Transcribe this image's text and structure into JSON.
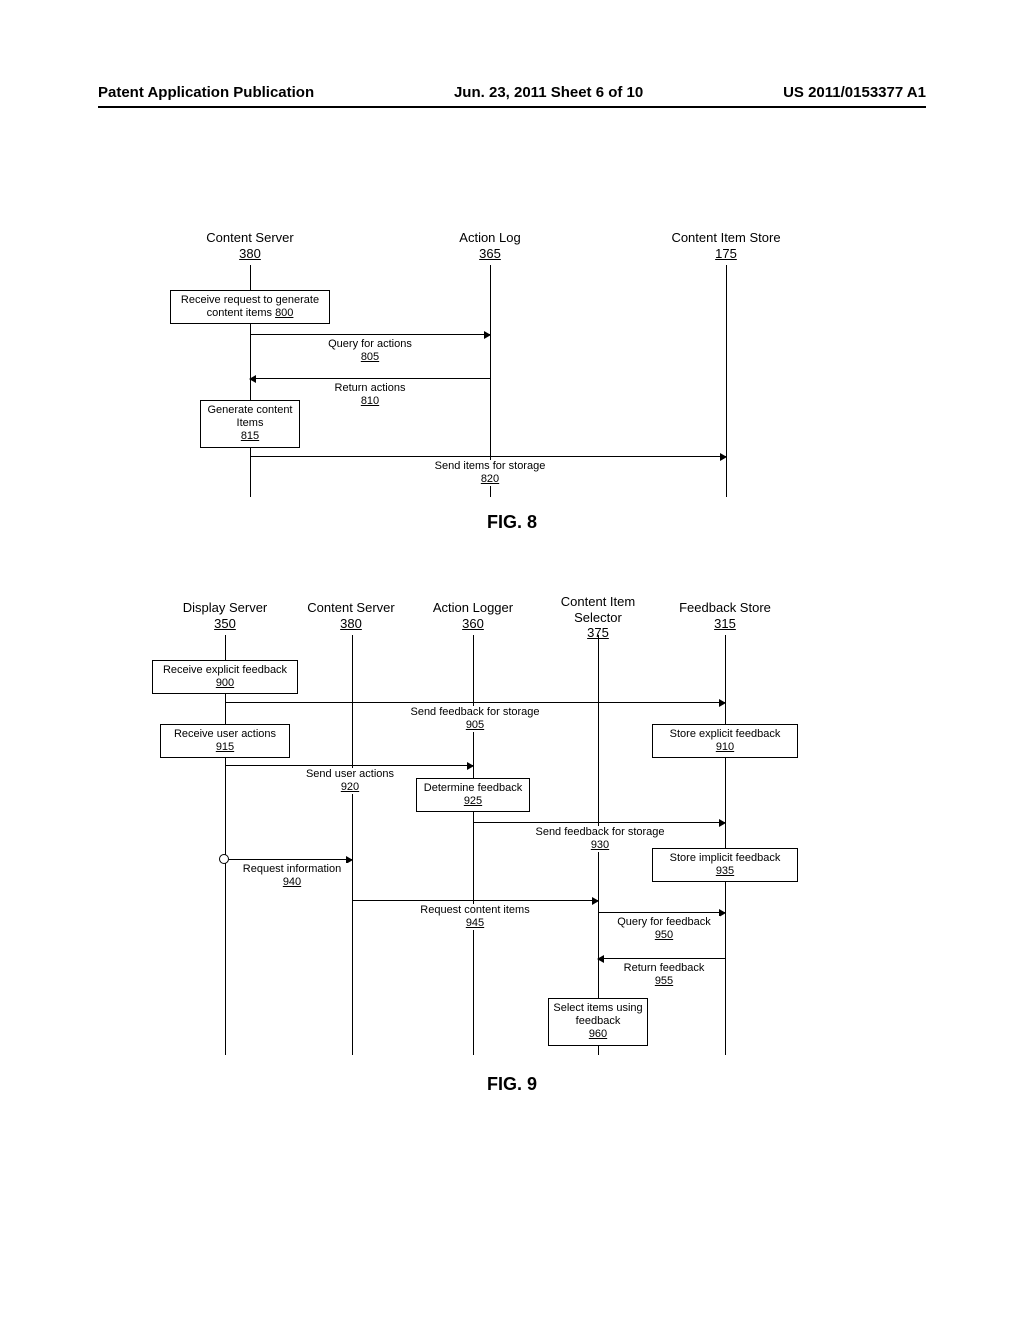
{
  "header": {
    "left": "Patent Application Publication",
    "center": "Jun. 23, 2011  Sheet 6 of 10",
    "right": "US 2011/0153377 A1"
  },
  "fig8": {
    "label": "FIG. 8",
    "lanes": [
      {
        "title": "Content Server",
        "num": "380"
      },
      {
        "title": "Action Log",
        "num": "365"
      },
      {
        "title": "Content Item Store",
        "num": "175"
      }
    ],
    "boxes": {
      "b800": {
        "text": "Receive request to generate content items",
        "num": "800"
      },
      "b815": {
        "text": "Generate content Items",
        "num": "815"
      }
    },
    "msgs": {
      "m805": {
        "text": "Query for actions",
        "num": "805"
      },
      "m810": {
        "text": "Return actions",
        "num": "810"
      },
      "m820": {
        "text": "Send items for storage",
        "num": "820"
      }
    }
  },
  "fig9": {
    "label": "FIG. 9",
    "lanes": [
      {
        "title": "Display Server",
        "num": "350"
      },
      {
        "title": "Content Server",
        "num": "380"
      },
      {
        "title": "Action Logger",
        "num": "360"
      },
      {
        "title": "Content Item Selector",
        "num": "375"
      },
      {
        "title": "Feedback Store",
        "num": "315"
      }
    ],
    "boxes": {
      "b900": {
        "text": "Receive explicit feedback",
        "num": "900"
      },
      "b910": {
        "text": "Store explicit feedback",
        "num": "910"
      },
      "b915": {
        "text": "Receive user actions",
        "num": "915"
      },
      "b925": {
        "text": "Determine feedback",
        "num": "925"
      },
      "b935": {
        "text": "Store implicit feedback",
        "num": "935"
      },
      "b960": {
        "text": "Select items using feedback",
        "num": "960"
      }
    },
    "msgs": {
      "m905": {
        "text": "Send feedback for storage",
        "num": "905"
      },
      "m920": {
        "text": "Send user actions",
        "num": "920"
      },
      "m930": {
        "text": "Send feedback for storage",
        "num": "930"
      },
      "m940": {
        "text": "Request information",
        "num": "940"
      },
      "m945": {
        "text": "Request content items",
        "num": "945"
      },
      "m950": {
        "text": "Query for feedback",
        "num": "950"
      },
      "m955": {
        "text": "Return feedback",
        "num": "955"
      }
    }
  }
}
